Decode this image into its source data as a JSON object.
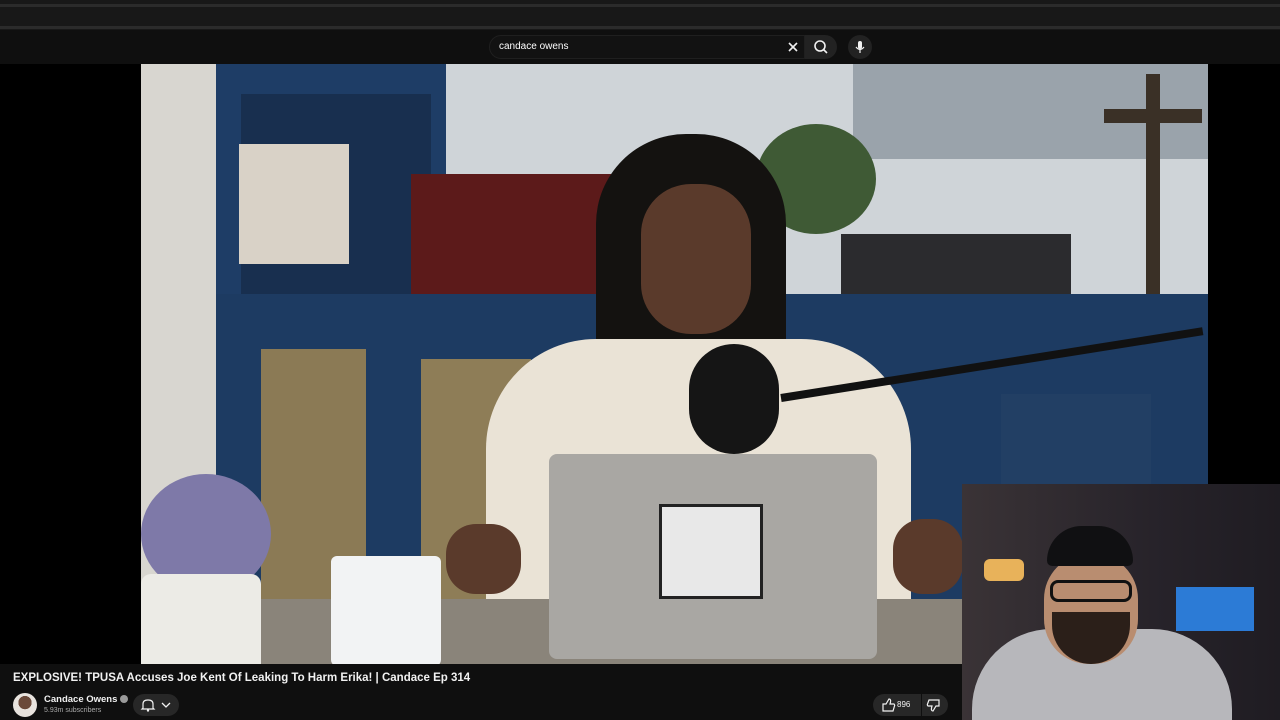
{
  "search": {
    "query": "candace owens"
  },
  "video": {
    "title": "EXPLOSIVE! TPUSA Accuses Joe Kent Of Leaking To Harm Erika! | Candace Ep 314"
  },
  "channel": {
    "name": "Candace Owens",
    "subscribers": "5.93m subscribers"
  },
  "actions": {
    "like_count": "896"
  },
  "icons": {
    "clear": "close-icon",
    "search": "search-icon",
    "mic": "microphone-icon",
    "bell": "notification-bell-icon",
    "like": "thumbs-up-icon",
    "dislike": "thumbs-down-icon",
    "verified": "verified-check-icon"
  }
}
